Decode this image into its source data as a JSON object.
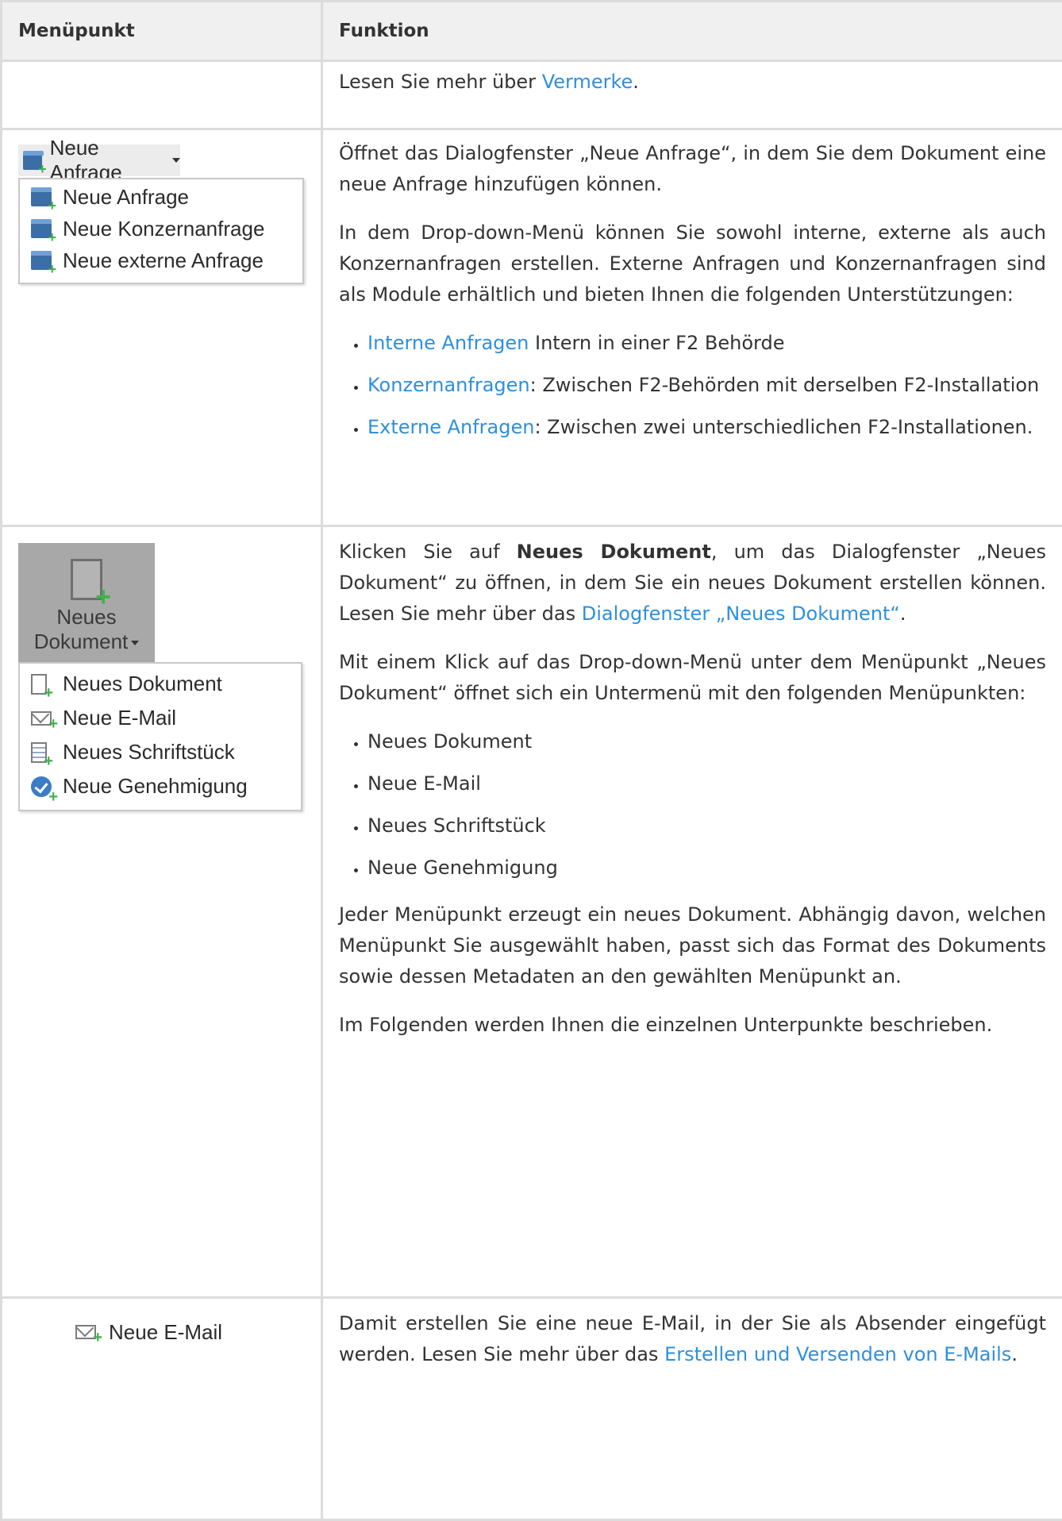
{
  "table": {
    "header": {
      "menu": "Menüpunkt",
      "function": "Funktion"
    },
    "row1": {
      "text_prefix": "Lesen Sie mehr über ",
      "link": "Vermerke",
      "text_suffix": "."
    },
    "row2": {
      "button_label": "Neue Anfrage",
      "menu_items": [
        "Neue Anfrage",
        "Neue Konzernanfrage",
        "Neue externe Anfrage"
      ],
      "p1": "Öffnet das Dialogfenster „Neue Anfrage“, in dem Sie dem Dokument eine neue Anfrage hinzufügen können.",
      "p2": "In dem Drop-down-Menü können Sie sowohl interne, externe als auch Konzernanfragen erstellen. Externe Anfragen und Konzernanfragen sind als Module erhältlich und bieten Ihnen die folgenden Unterstützungen:",
      "bullets": [
        {
          "link": "Interne Anfragen",
          "text": " Intern in einer F2 Behörde"
        },
        {
          "link": "Konzernanfragen",
          "text": ": Zwischen F2-Behörden mit derselben F2-Installation"
        },
        {
          "link": "Externe Anfragen",
          "text": ": Zwischen zwei unterschiedlichen F2-Installationen."
        }
      ]
    },
    "row3": {
      "button_line1": "Neues",
      "button_line2": "Dokument",
      "menu_items": [
        "Neues Dokument",
        "Neue E-Mail",
        "Neues Schriftstück",
        "Neue Genehmigung"
      ],
      "p1_prefix": "Klicken Sie auf ",
      "p1_bold": "Neues Dokument",
      "p1_middle": ", um das Dialogfenster „Neues Dokument“ zu öffnen, in dem Sie ein neues Dokument erstellen können. Lesen Sie mehr über das ",
      "p1_link": "Dialogfenster „Neues Dokument“",
      "p1_suffix": ".",
      "p2": "Mit einem Klick auf das Drop-down-Menü unter dem Menüpunkt „Neues Dokument“ öffnet sich ein Untermenü mit den folgenden Menüpunkten:",
      "bullets": [
        "Neues Dokument",
        "Neue E-Mail",
        "Neues Schriftstück",
        "Neue Genehmigung"
      ],
      "p3": "Jeder Menüpunkt erzeugt ein neues Dokument. Abhängig davon, welchen Menüpunkt Sie ausgewählt haben, passt sich das Format des Dokuments sowie dessen Metadaten an den gewählten Menüpunkt an.",
      "p4": "Im Folgenden werden Ihnen die einzelnen Unterpunkte beschrieben."
    },
    "row4": {
      "button_label": "Neue E-Mail",
      "p1_prefix": "Damit erstellen Sie eine neue E-Mail, in der Sie als Absender eingefügt werden. Lesen Sie mehr über das ",
      "p1_link": "Erstellen und Versenden von E-Mails",
      "p1_suffix": "."
    }
  }
}
